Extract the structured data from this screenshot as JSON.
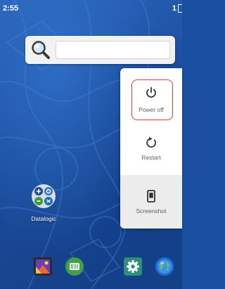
{
  "status_bar": {
    "time": "2:55",
    "right_text": "1"
  },
  "search_widget": {
    "icon": "search-icon",
    "placeholder": ""
  },
  "power_menu": {
    "items": [
      {
        "label": "Power off",
        "icon": "power-icon",
        "highlighted": true,
        "highlight_color": "#e53935"
      },
      {
        "label": "Restart",
        "icon": "restart-icon"
      },
      {
        "label": "Screenshot",
        "icon": "screenshot-icon"
      }
    ]
  },
  "home_apps": [
    {
      "label": "Datalogic",
      "icon": "datalogic-icon"
    }
  ],
  "dock": [
    {
      "icon": "gallery-icon"
    },
    {
      "icon": "barcode-scanner-icon"
    },
    {
      "icon": "settings-icon"
    },
    {
      "icon": "browser-globe-icon"
    }
  ],
  "colors": {
    "wallpaper": "#1a4fa0",
    "menu_background": "#ffffff",
    "menu_text": "#5f5f5f",
    "highlight": "#e53935"
  }
}
